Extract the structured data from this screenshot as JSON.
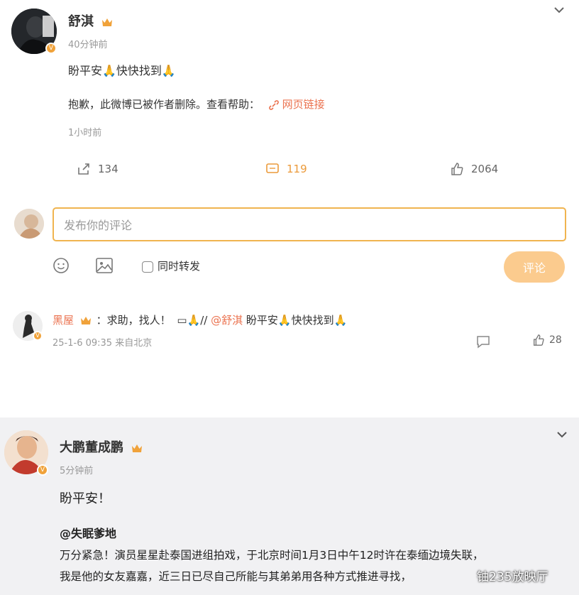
{
  "post1": {
    "author": "舒淇",
    "time": "40分钟前",
    "content": "盼平安🙏快快找到🙏",
    "deleted_notice": "抱歉，此微博已被作者删除。查看帮助：",
    "help_link": "网页链接",
    "deleted_time": "1小时前",
    "repost_count": "134",
    "comment_count": "119",
    "like_count": "2064",
    "menu_icon": "chevron-down-icon"
  },
  "composer": {
    "placeholder": "发布你的评论",
    "repost_label": "同时转发",
    "submit_label": "评论"
  },
  "comment1": {
    "author": "黑屋",
    "text_prefix": "：求助，找人！",
    "mention": "@舒淇",
    "text_suffix": "盼平安🙏快快找到🙏",
    "time_location": "25-1-6 09:35 来自北京",
    "like_count": "28"
  },
  "post2": {
    "author": "大鹏董成鹏",
    "time": "5分钟前",
    "content": "盼平安！",
    "quoted_author": "@失眠爹地",
    "quoted_line1": "万分紧急！演员星星赴泰国进组拍戏，于北京时间1月3日中午12时许在泰缅边境失联，",
    "quoted_line2": "我是他的女友嘉嘉，近三日已尽自己所能与其弟弟用各种方式推进寻找，",
    "menu_icon": "chevron-down-icon"
  },
  "watermark": "铀235放映厅",
  "colors": {
    "accent": "#f0a23a",
    "link": "#eb7350",
    "submit_bg": "#fbcb8e",
    "input_border": "#f0b44f"
  }
}
